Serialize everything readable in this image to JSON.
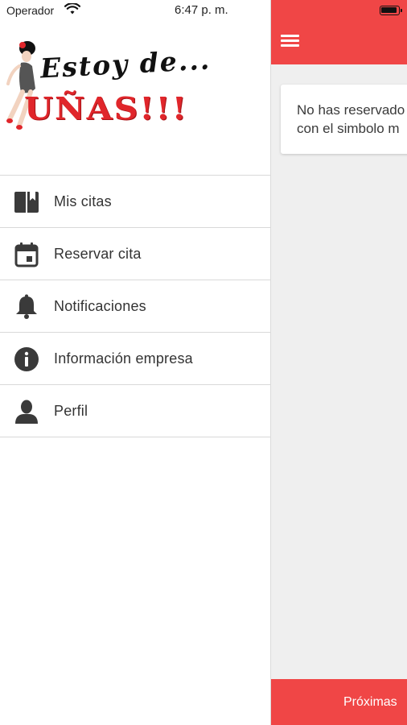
{
  "status_bar": {
    "carrier": "Operador",
    "time": "6:47 p. m."
  },
  "logo": {
    "line1": "Estoy de...",
    "line2": "UÑAS!!!"
  },
  "menu": {
    "items": [
      {
        "label": "Mis citas",
        "icon": "book-icon"
      },
      {
        "label": "Reservar cita",
        "icon": "calendar-icon"
      },
      {
        "label": "Notificaciones",
        "icon": "bell-icon"
      },
      {
        "label": "Información empresa",
        "icon": "info-icon"
      },
      {
        "label": "Perfil",
        "icon": "person-icon"
      }
    ]
  },
  "main": {
    "message_line1": "No has reservado",
    "message_line2": "con el simbolo m"
  },
  "footer": {
    "tab_label": "Próximas"
  },
  "colors": {
    "accent": "#f04646",
    "logo_red": "#e0262b",
    "icon_gray": "#333333"
  }
}
